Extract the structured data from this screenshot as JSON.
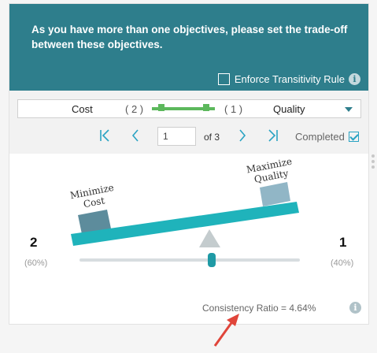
{
  "header": {
    "message": "As you have more than one objectives, please set the trade-off between these objectives.",
    "enforce_label": "Enforce Transitivity Rule"
  },
  "pair": {
    "left_name": "Cost",
    "left_value": "( 2 )",
    "right_value": "( 1 )",
    "right_name": "Quality"
  },
  "pagination": {
    "current_page": "1",
    "of_label": "of 3",
    "completed_label": "Completed"
  },
  "balance": {
    "left_label": [
      "Minimize",
      "Cost"
    ],
    "right_label": [
      "Maximize",
      "Quality"
    ],
    "left_weight": "2",
    "left_pct": "(60%)",
    "right_weight": "1",
    "right_pct": "(40%)",
    "slider_fraction": 0.6
  },
  "footer": {
    "consistency_label": "Consistency Ratio  =  4.64%"
  },
  "colors": {
    "header": "#2e7e8c",
    "accent": "#2aa3c3",
    "beam": "#1fb3bb",
    "slider": "#1f9aa5",
    "left_box": "#5d8c9c",
    "right_box": "#91b6c6",
    "arrow": "#e0453a"
  },
  "icons": {
    "info": "info-icon",
    "first": "first-page-icon",
    "prev": "prev-page-icon",
    "next": "next-page-icon",
    "last": "last-page-icon",
    "dropdown": "chevron-down-icon"
  }
}
